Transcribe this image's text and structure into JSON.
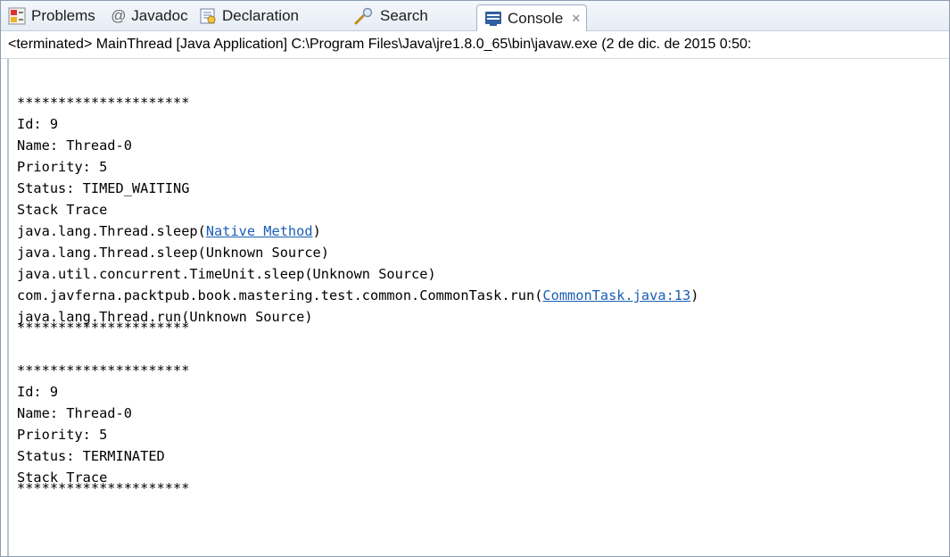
{
  "tabs": [
    {
      "label": "Problems",
      "icon": "problems-icon"
    },
    {
      "label": "Javadoc",
      "icon": "at-icon"
    },
    {
      "label": "Declaration",
      "icon": "declaration-icon"
    },
    {
      "label": "Search",
      "icon": "search-icon"
    },
    {
      "label": "Console",
      "icon": "console-icon",
      "active": true,
      "close_glyph": "✕"
    }
  ],
  "launch_info": "<terminated> MainThread [Java Application] C:\\Program Files\\Java\\jre1.8.0_65\\bin\\javaw.exe (2 de dic. de 2015 0:50:",
  "console_lines": {
    "sep1": "*********************",
    "id1": "Id: 9",
    "name1": "Name: Thread-0",
    "prio1": "Priority: 5",
    "status1": "Status: TIMED_WAITING",
    "trace1": "Stack Trace",
    "f1_prefix": "java.lang.Thread.sleep(",
    "f1_link": "Native Method",
    "f1_suffix": ")",
    "f2": "java.lang.Thread.sleep(Unknown Source)",
    "f3": "java.util.concurrent.TimeUnit.sleep(Unknown Source)",
    "f4_prefix": "com.javferna.packtpub.book.mastering.test.common.CommonTask.run(",
    "f4_link": "CommonTask.java:13",
    "f4_suffix": ")",
    "f5": "java.lang.Thread.run(Unknown Source)",
    "sep2": "*********************",
    "sep3": "*********************",
    "id2": "Id: 9",
    "name2": "Name: Thread-0",
    "prio2": "Priority: 5",
    "status2": "Status: TERMINATED",
    "trace2": "Stack Trace",
    "sep4": "*********************"
  },
  "colors": {
    "link": "#1a5fb4",
    "tab_bar": "#e6edf6",
    "border": "#8b9cb0"
  }
}
